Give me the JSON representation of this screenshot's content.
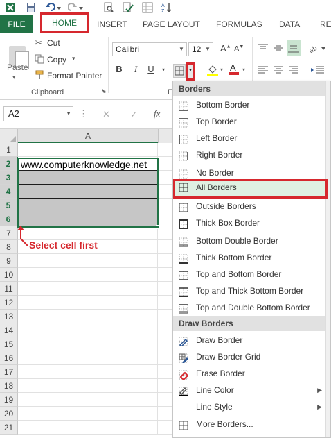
{
  "ribbon_tabs": {
    "file": "FILE",
    "home": "HOME",
    "insert": "INSERT",
    "page_layout": "PAGE LAYOUT",
    "formulas": "FORMULAS",
    "data": "DATA",
    "review": "REVI"
  },
  "clipboard": {
    "paste": "Paste",
    "cut": "Cut",
    "copy": "Copy",
    "format_painter": "Format Painter",
    "group_label": "Clipboard"
  },
  "font": {
    "name": "Calibri",
    "size": "12",
    "bold": "B",
    "italic": "I",
    "underline": "U",
    "group_label_fragment": "F"
  },
  "formula_bar": {
    "name_box": "A2",
    "cancel": "✕",
    "enter": "✓",
    "fx": "fx",
    "value": ""
  },
  "sheet": {
    "column_header": "A",
    "row_numbers": [
      "1",
      "2",
      "3",
      "4",
      "5",
      "6",
      "7",
      "8",
      "9",
      "10",
      "11",
      "12",
      "13",
      "14",
      "15",
      "16",
      "17",
      "18",
      "19",
      "20",
      "21"
    ],
    "selected_rows": [
      "2",
      "3",
      "4",
      "5",
      "6"
    ],
    "cell_a2": "www.computerknowledge.net",
    "annotation": "Select cell first"
  },
  "borders_menu": {
    "section_borders": "Borders",
    "items": [
      "Bottom Border",
      "Top Border",
      "Left Border",
      "Right Border",
      "No Border",
      "All Borders",
      "Outside Borders",
      "Thick Box Border",
      "Bottom Double Border",
      "Thick Bottom Border",
      "Top and Bottom Border",
      "Top and Thick Bottom Border",
      "Top and Double Bottom Border"
    ],
    "section_draw": "Draw Borders",
    "draw_items": [
      "Draw Border",
      "Draw Border Grid",
      "Erase Border",
      "Line Color",
      "Line Style",
      "More Borders..."
    ],
    "highlighted": "All Borders"
  },
  "colors": {
    "excel_green": "#217346",
    "annotation_red": "#d6282e",
    "selection_fill": "#c6c6c6",
    "highlight_fill": "#dff0e2"
  }
}
